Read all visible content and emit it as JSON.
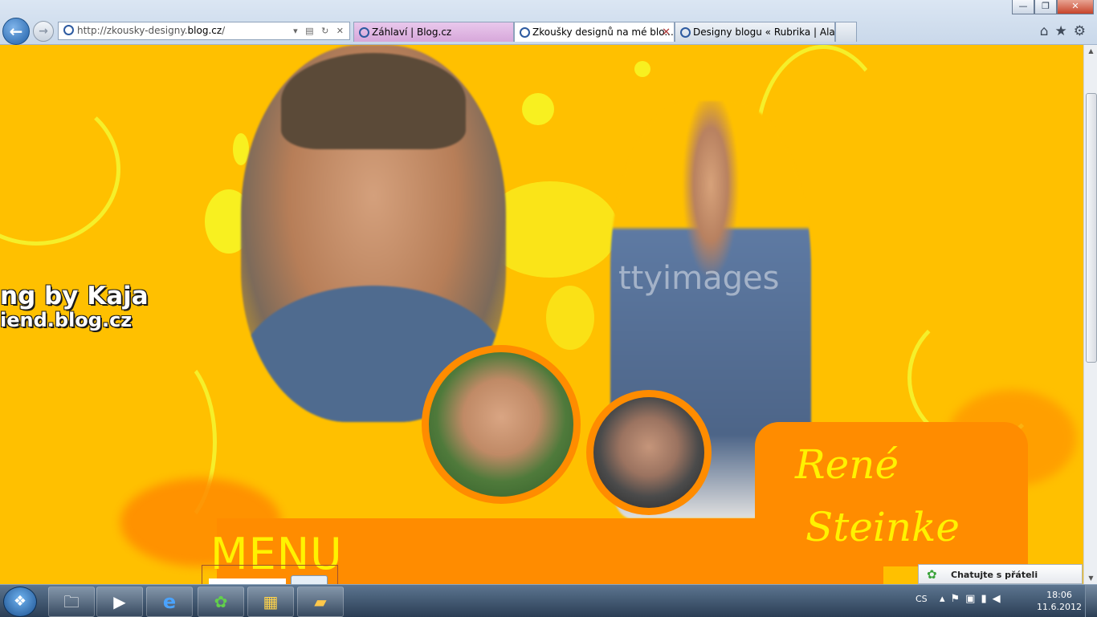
{
  "browser": {
    "url_prefix": "http://zkousky-designy.",
    "url_domain": "blog.cz",
    "url_suffix": "/",
    "tabs": [
      {
        "label": "Záhlaví | Blog.cz"
      },
      {
        "label": "Zkoušky designů na mé blo..."
      },
      {
        "label": "Designy blogu « Rubrika | Alar..."
      }
    ],
    "window_buttons": {
      "minimize": "—",
      "restore": "❐",
      "close": "✕"
    },
    "right_icons": "⌂★⚙"
  },
  "page": {
    "credit_line1": "ng by Kaja",
    "credit_line2": "iend.blog.cz",
    "watermark": "ttyimages",
    "name_line1": "René",
    "name_line2": "Steinke",
    "menu_label": "MENU"
  },
  "chat": {
    "label": "Chatujte s přáteli"
  },
  "taskbar": {
    "language": "CS",
    "time": "18:06",
    "date": "11.6.2012",
    "apps": [
      {
        "name": "explorer",
        "glyph": "🗀"
      },
      {
        "name": "media-player",
        "glyph": "▶"
      },
      {
        "name": "internet-explorer",
        "glyph": "e"
      },
      {
        "name": "icq",
        "glyph": "✿"
      },
      {
        "name": "photo-app",
        "glyph": "▦"
      },
      {
        "name": "video-app",
        "glyph": "▰"
      }
    ]
  },
  "colors": {
    "page_bg": "#ffc000",
    "accent_orange": "#ff8c00",
    "name_yellow": "#fff200"
  }
}
